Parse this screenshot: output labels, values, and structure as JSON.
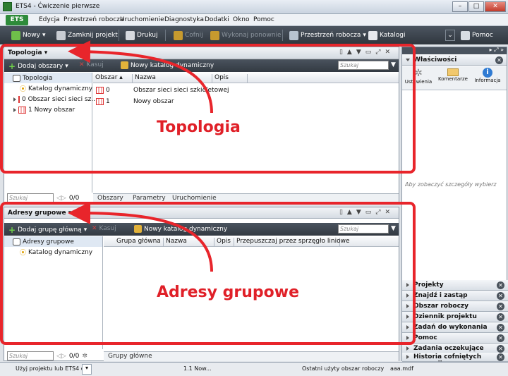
{
  "window": {
    "title": "ETS4 - Ćwiczenie pierwsze"
  },
  "menu": {
    "ets": "ETS",
    "items": [
      "Edycja",
      "Przestrzeń robocza",
      "Uruchomienie",
      "Diagnostyka",
      "Dodatki",
      "Okno",
      "Pomoc"
    ]
  },
  "toolbar": {
    "new": "Nowy",
    "close_project": "Zamknij projekt",
    "print": "Drukuj",
    "undo": "Cofnij",
    "redo": "Wykonaj ponownie",
    "workspace": "Przestrzeń robocza",
    "catalogs": "Katalogi",
    "help": "Pomoc"
  },
  "topology": {
    "title": "Topologia",
    "add_areas": "Dodaj obszary",
    "delete": "Kasuj",
    "new_dynamic_catalog": "Nowy katalog dynamiczny",
    "search_placeholder": "Szukaj",
    "tree": [
      "Topologia",
      "Katalog dynamiczny",
      "0 Obszar sieci sieci sz...",
      "1 Nowy obszar"
    ],
    "columns": [
      "Obszar",
      "Nazwa",
      "Opis"
    ],
    "rows": [
      {
        "area": "0",
        "name": "Obszar sieci sieci szkieletowej"
      },
      {
        "area": "1",
        "name": "Nowy obszar"
      }
    ],
    "search_left": "Szukaj",
    "count": "0/0",
    "tabs": [
      "Obszary",
      "Parametry",
      "Uruchomienie"
    ]
  },
  "groups": {
    "title": "Adresy grupowe",
    "add_main_group": "Dodaj grupę główną",
    "delete": "Kasuj",
    "new_dynamic_catalog": "Nowy katalog dynamiczny",
    "search_placeholder": "Szukaj",
    "tree": [
      "Adresy grupowe",
      "Katalog dynamiczny"
    ],
    "columns": [
      "Grupa główna",
      "Nazwa",
      "Opis",
      "Przepuszczaj przez sprzęgło liniowe"
    ],
    "search_left": "Szukaj",
    "count": "0/0",
    "tabs": [
      "Grupy główne"
    ]
  },
  "properties": {
    "title": "Właściwości",
    "tabs": [
      "Ustawienia",
      "Komentarze",
      "Informacja"
    ],
    "hint": "Aby zobaczyć szczegóły wybierz"
  },
  "side_panels": [
    "Projekty",
    "Znajdź i zastąp",
    "Obszar roboczy",
    "Dziennik projektu",
    "Zadań do wykonania",
    "Pomoc",
    "Zadania oczekujące",
    "Historia cofniętych operacji"
  ],
  "statusbar": {
    "left": "Użyj projektu lub ETS4 d...",
    "mid": "1.1 Now...",
    "last_area": "Ostatni użyty obszar roboczy",
    "file": "aaa.mdf"
  },
  "annotations": {
    "topology": "Topologia",
    "groups": "Adresy grupowe",
    "color": "#e8252b"
  }
}
